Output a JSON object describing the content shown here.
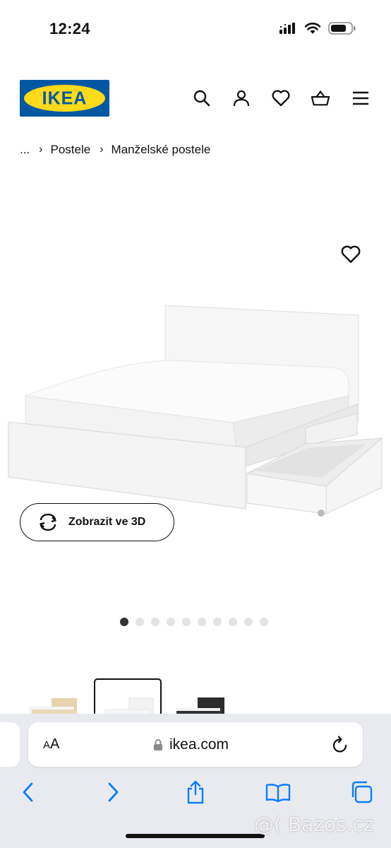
{
  "status_bar": {
    "time": "12:24"
  },
  "brand": {
    "logo_text": "IKEA",
    "blue": "#0058a3",
    "yellow": "#ffda1a"
  },
  "header": {
    "icons": [
      "search-icon",
      "account-icon",
      "wishlist-icon",
      "cart-icon",
      "menu-icon"
    ]
  },
  "breadcrumb": {
    "ellipsis": "...",
    "items": [
      "Postele",
      "Manželské postele"
    ]
  },
  "product": {
    "view3d_label": "Zobrazit ve 3D",
    "carousel": {
      "total": 10,
      "active": 1
    },
    "variants": [
      "oak-veneer",
      "white",
      "black-brown"
    ],
    "selected_variant": "white"
  },
  "browser": {
    "aa_label_small": "A",
    "aa_label_large": "A",
    "url": "ikea.com",
    "accent": "#0a7cff"
  },
  "watermark": "@( Bazos.cz"
}
